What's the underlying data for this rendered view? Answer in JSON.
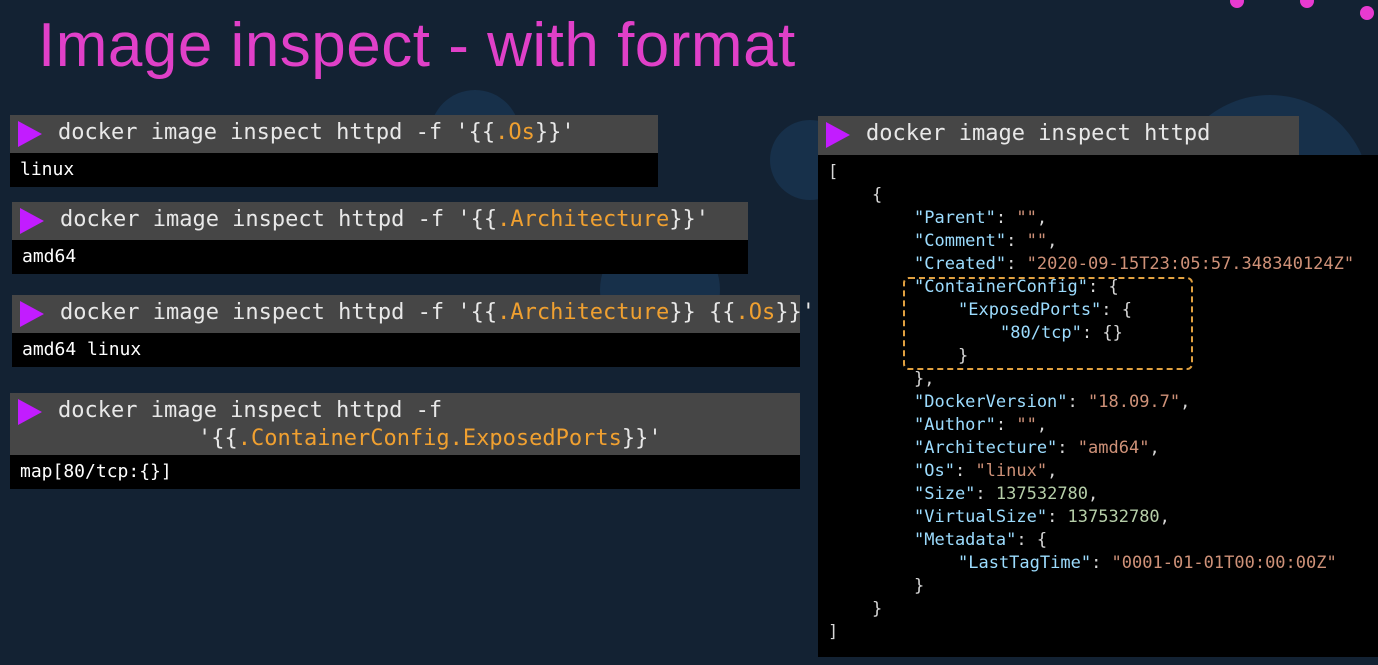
{
  "slide": {
    "title": "Image inspect - with format"
  },
  "commands": [
    {
      "prefix": "docker image inspect httpd -f '{{",
      "highlight": ".Os",
      "suffix": "}}'",
      "output": "linux"
    },
    {
      "prefix": "docker image inspect httpd -f '{{",
      "highlight": ".Architecture",
      "suffix": "}}'",
      "output": "amd64"
    },
    {
      "prefix": "docker image inspect httpd -f '{{",
      "highlight1": ".Architecture",
      "middle": "}} {{",
      "highlight2": ".Os",
      "suffix": "}}'",
      "output": "amd64 linux"
    },
    {
      "line1": "docker image inspect httpd -f",
      "prefix": "'{{",
      "highlight": ".ContainerConfig.ExposedPorts",
      "suffix": "}}'",
      "output": "map[80/tcp:{}]"
    }
  ],
  "full_inspect": {
    "command": "docker image inspect httpd",
    "open_bracket": "[",
    "open_brace": "{",
    "parent_key": "\"Parent\"",
    "parent_val": "\"\"",
    "comment_key": "\"Comment\"",
    "comment_val": "\"\"",
    "created_key": "\"Created\"",
    "created_val": "\"2020-09-15T23:05:57.348340124Z\"",
    "containerconfig_key": "\"ContainerConfig\"",
    "exposedports_key": "\"ExposedPorts\"",
    "port_key": "\"80/tcp\"",
    "port_val": "{}",
    "close_inner": "}",
    "close_cc": "},",
    "dockerversion_key": "\"DockerVersion\"",
    "dockerversion_val": "\"18.09.7\"",
    "author_key": "\"Author\"",
    "author_val": "\"\"",
    "architecture_key": "\"Architecture\"",
    "architecture_val": "\"amd64\"",
    "os_key": "\"Os\"",
    "os_val": "\"linux\"",
    "size_key": "\"Size\"",
    "size_val": "137532780",
    "virtualsize_key": "\"VirtualSize\"",
    "virtualsize_val": "137532780",
    "metadata_key": "\"Metadata\"",
    "lasttagtime_key": "\"LastTagTime\"",
    "lasttagtime_val": "\"0001-01-01T00:00:00Z\"",
    "close_metadata": "}",
    "close_obj": "}",
    "close_bracket": "]"
  },
  "colors": {
    "title": "#e040c8",
    "prompt_triangle": "#c21cff",
    "highlight": "#f0a030",
    "json_key": "#9cdcfe",
    "json_string": "#ce9178",
    "json_number": "#b5cea8"
  }
}
